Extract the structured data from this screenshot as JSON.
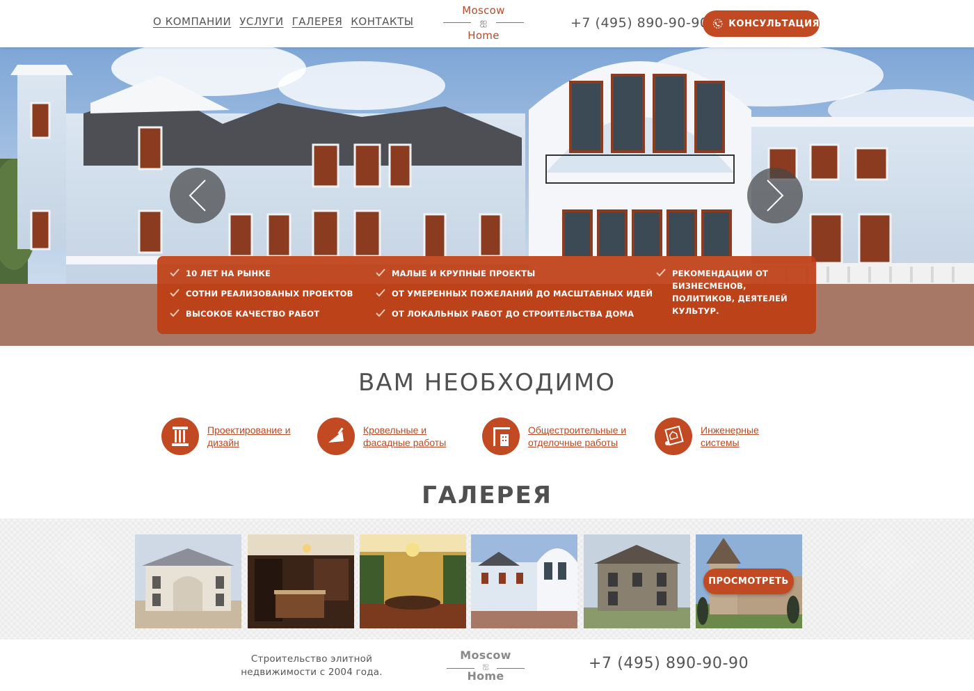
{
  "header": {
    "nav": [
      "О КОМПАНИИ",
      "УСЛУГИ",
      "ГАЛЕРЕЯ",
      "КОНТАКТЫ"
    ],
    "logo": {
      "line1": "Moscow",
      "line2": "Home"
    },
    "phone": "+7 (495) 890-90-90",
    "consult_button": "КОНСУЛЬТАЦИЯ"
  },
  "hero": {
    "features": [
      "10 ЛЕТ НА РЫНКЕ",
      "СОТНИ РЕАЛИЗОВАНЫХ ПРОЕКТОВ",
      "ВЫСОКОЕ КАЧЕСТВО РАБОТ",
      "МАЛЫЕ И КРУПНЫЕ ПРОЕКТЫ",
      "ОТ УМЕРЕННЫХ ПОЖЕЛАНИЙ ДО МАСШТАБНЫХ ИДЕЙ",
      "ОТ ЛОКАЛЬНЫХ РАБОТ ДО СТРОИТЕЛЬСТВА ДОМА",
      "РЕКОМЕНДАЦИИ ОТ БИЗНЕСМЕНОВ, ПОЛИТИКОВ, ДЕЯТЕЛЕЙ КУЛЬТУР."
    ]
  },
  "needs": {
    "title": "ВАМ НЕОБХОДИМО",
    "services": [
      {
        "label": "Проектирование и дизайн",
        "icon": "column-icon"
      },
      {
        "label": "Кровельные и фасадные работы",
        "icon": "trowel-icon"
      },
      {
        "label": "Общестроительные и отделочные работы",
        "icon": "crane-icon"
      },
      {
        "label": "Инженерные системы",
        "icon": "blueprint-icon"
      }
    ]
  },
  "gallery": {
    "title": "ГАЛЕРЕЯ",
    "view_button": "ПРОСМОТРЕТЬ"
  },
  "footer": {
    "text": "Строительство элитной недвижимости с 2004 года.",
    "logo": {
      "line1": "Moscow",
      "line2": "Home"
    },
    "phone": "+7 (495) 890-90-90"
  },
  "colors": {
    "accent": "#c24a22",
    "text": "#555555"
  }
}
